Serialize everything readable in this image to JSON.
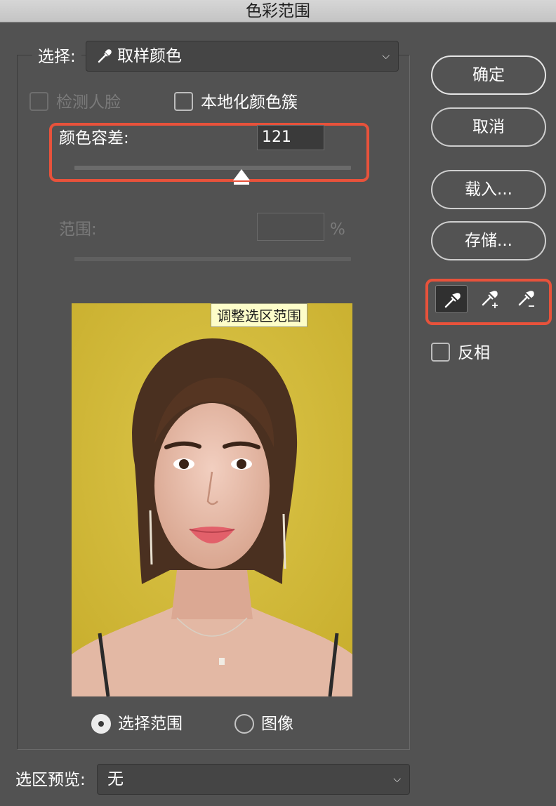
{
  "window": {
    "title": "色彩范围"
  },
  "select": {
    "label": "选择:",
    "value": "取样颜色",
    "icon": "eyedropper-icon"
  },
  "options": {
    "detect_faces": {
      "label": "检测人脸",
      "checked": false,
      "enabled": false
    },
    "localized_clusters": {
      "label": "本地化颜色簇",
      "checked": false,
      "enabled": true
    }
  },
  "fuzziness": {
    "label": "颜色容差:",
    "value": "121",
    "max": 200
  },
  "range": {
    "label": "范围:",
    "value": "",
    "unit": "%",
    "enabled": false
  },
  "preview": {
    "tooltip": "调整选区范围"
  },
  "view_mode": {
    "selection_label": "选择范围",
    "image_label": "图像",
    "selected": "selection"
  },
  "buttons": {
    "ok": "确定",
    "cancel": "取消",
    "load": "载入...",
    "save": "存储..."
  },
  "tools": [
    {
      "name": "eyedropper-icon",
      "active": true
    },
    {
      "name": "eyedropper-add-icon",
      "active": false
    },
    {
      "name": "eyedropper-subtract-icon",
      "active": false
    }
  ],
  "invert": {
    "label": "反相",
    "checked": false
  },
  "selection_preview": {
    "label": "选区预览:",
    "value": "无"
  },
  "colors": {
    "highlight": "#e8523b",
    "panel": "#525252",
    "field": "#454545"
  }
}
